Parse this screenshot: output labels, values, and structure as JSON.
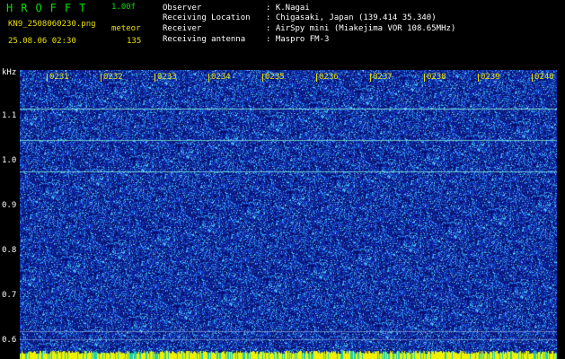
{
  "app": {
    "name": "HROFFT",
    "version": "1.00f",
    "filename": "KN9_2508060230.png",
    "mode": "meteor",
    "datetime": "25.08.06 02:30",
    "count": "135"
  },
  "info": {
    "rows": [
      {
        "label": "Observer",
        "value": ": K.Nagai"
      },
      {
        "label": "Receiving Location",
        "value": ": Chigasaki, Japan (139.414 35.340)"
      },
      {
        "label": "Receiver",
        "value": ": AirSpy mini (Miakejima VOR 108.65MHz)"
      },
      {
        "label": "Receiving antenna",
        "value": ": Maspro FM-3"
      }
    ]
  },
  "axis": {
    "unit": "kHz",
    "y_ticks": [
      "1.1",
      "1.0",
      "0.9",
      "0.8",
      "0.7",
      "0.6"
    ],
    "x_ticks": [
      "0231",
      "0232",
      "0233",
      "0234",
      "0235",
      "0236",
      "0237",
      "0238",
      "0239",
      "0240"
    ]
  },
  "colors": {
    "bg": "#000000",
    "noise_dark": "#0a1260",
    "noise_mid": "#1633b8",
    "noise_bright": "#3fd0ff",
    "carrier": "#7ee8e0",
    "bar_yellow": "#f0f000",
    "text_yellow": "#e8e000",
    "text_green": "#00e000"
  }
}
